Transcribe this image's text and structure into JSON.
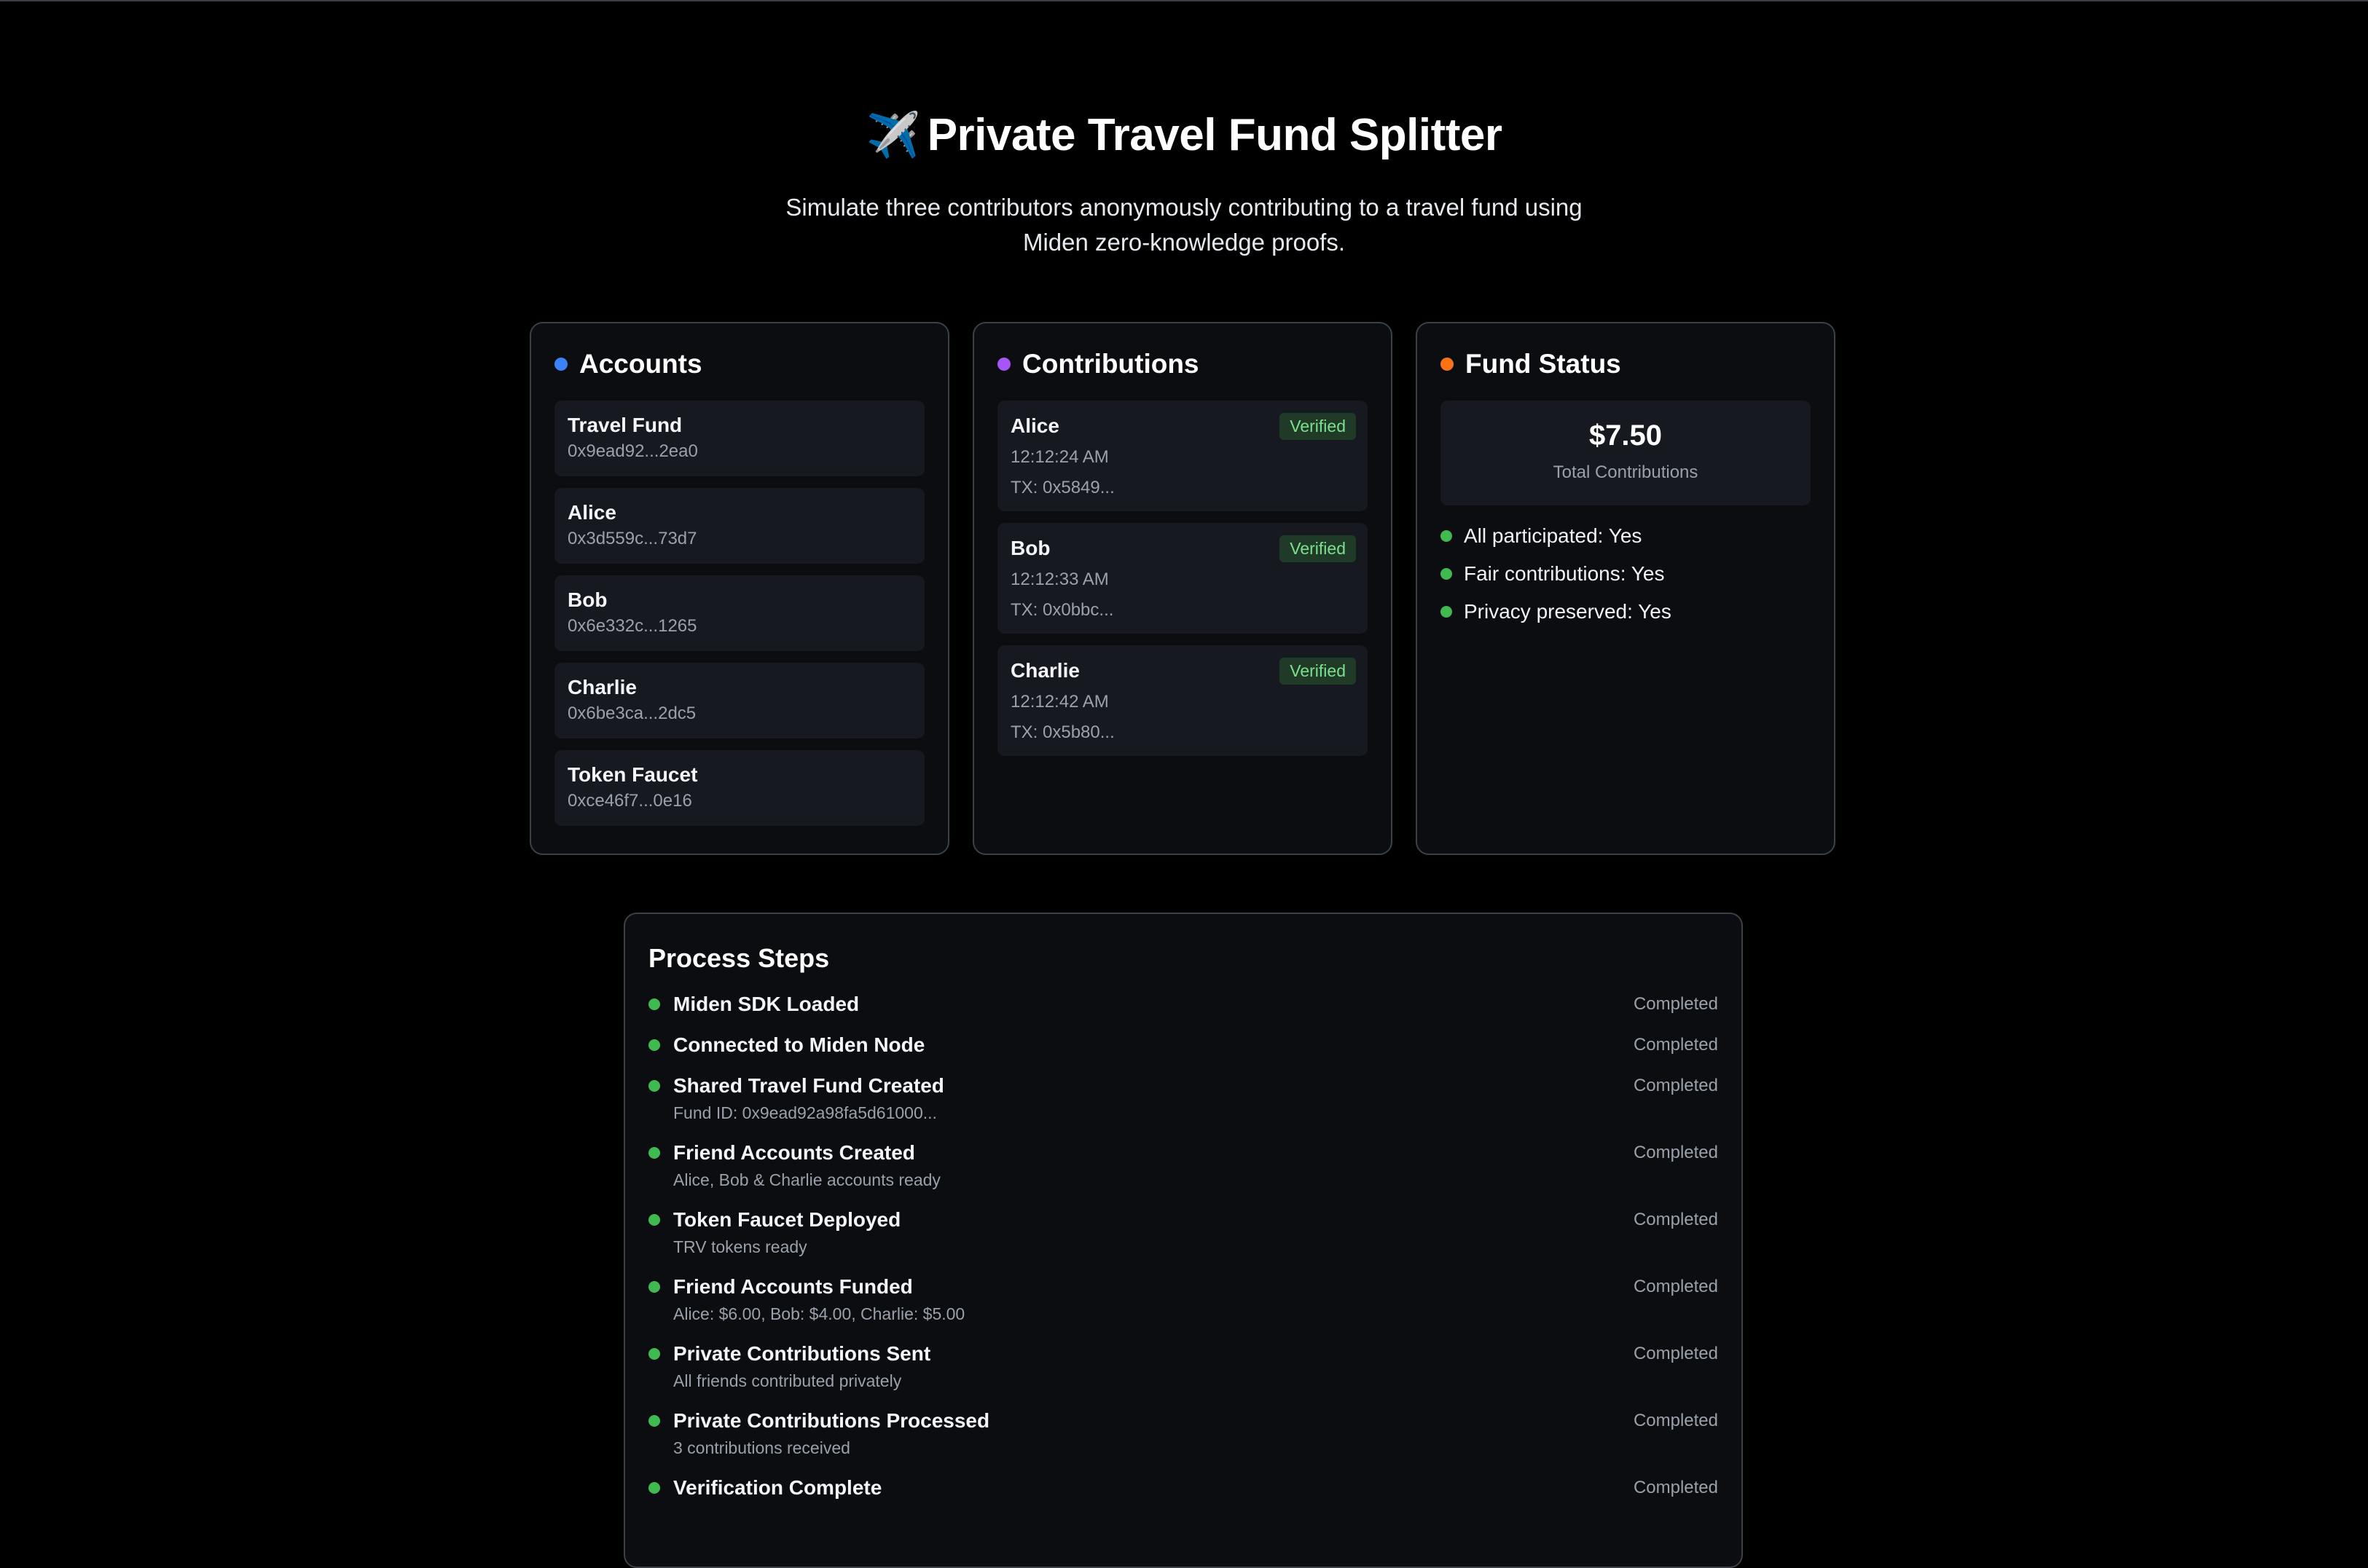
{
  "header": {
    "icon": "✈️",
    "title": "Private Travel Fund Splitter",
    "subtitle": "Simulate three contributors anonymously contributing to a travel fund using Miden zero-knowledge proofs."
  },
  "colors": {
    "accounts_dot": "#3b82f6",
    "contributions_dot": "#a855f7",
    "fund_status_dot": "#f97316",
    "success": "#3fb950"
  },
  "accounts": {
    "title": "Accounts",
    "items": [
      {
        "name": "Travel Fund",
        "address": "0x9ead92...2ea0"
      },
      {
        "name": "Alice",
        "address": "0x3d559c...73d7"
      },
      {
        "name": "Bob",
        "address": "0x6e332c...1265"
      },
      {
        "name": "Charlie",
        "address": "0x6be3ca...2dc5"
      },
      {
        "name": "Token Faucet",
        "address": "0xce46f7...0e16"
      }
    ]
  },
  "contributions": {
    "title": "Contributions",
    "items": [
      {
        "name": "Alice",
        "badge": "Verified",
        "time": "12:12:24 AM",
        "tx": "TX: 0x5849..."
      },
      {
        "name": "Bob",
        "badge": "Verified",
        "time": "12:12:33 AM",
        "tx": "TX: 0x0bbc..."
      },
      {
        "name": "Charlie",
        "badge": "Verified",
        "time": "12:12:42 AM",
        "tx": "TX: 0x5b80..."
      }
    ]
  },
  "fund_status": {
    "title": "Fund Status",
    "total_amount": "$7.50",
    "total_label": "Total Contributions",
    "items": [
      "All participated: Yes",
      "Fair contributions: Yes",
      "Privacy preserved: Yes"
    ]
  },
  "process_steps": {
    "title": "Process Steps",
    "items": [
      {
        "label": "Miden SDK Loaded",
        "detail": "",
        "status": "Completed"
      },
      {
        "label": "Connected to Miden Node",
        "detail": "",
        "status": "Completed"
      },
      {
        "label": "Shared Travel Fund Created",
        "detail": "Fund ID: 0x9ead92a98fa5d61000...",
        "status": "Completed"
      },
      {
        "label": "Friend Accounts Created",
        "detail": "Alice, Bob & Charlie accounts ready",
        "status": "Completed"
      },
      {
        "label": "Token Faucet Deployed",
        "detail": "TRV tokens ready",
        "status": "Completed"
      },
      {
        "label": "Friend Accounts Funded",
        "detail": "Alice: $6.00, Bob: $4.00, Charlie: $5.00",
        "status": "Completed"
      },
      {
        "label": "Private Contributions Sent",
        "detail": "All friends contributed privately",
        "status": "Completed"
      },
      {
        "label": "Private Contributions Processed",
        "detail": "3 contributions received",
        "status": "Completed"
      },
      {
        "label": "Verification Complete",
        "detail": "",
        "status": "Completed"
      }
    ]
  }
}
